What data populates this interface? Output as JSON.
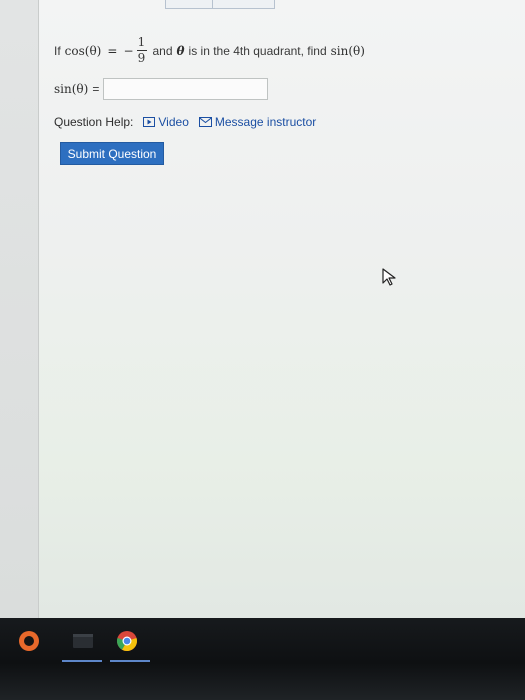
{
  "question": {
    "prefix": "If",
    "func1": "cos(θ)",
    "equals": "=",
    "minus": "−",
    "numerator": "1",
    "denominator": "9",
    "middle_text": "and",
    "theta": "θ",
    "suffix_text": "is in the 4th quadrant, find",
    "func2": "sin(θ)"
  },
  "answer": {
    "label": "sin(θ)",
    "equals": "=",
    "value": ""
  },
  "help": {
    "label": "Question Help:",
    "video_label": "Video",
    "message_label": "Message instructor"
  },
  "submit": {
    "label": "Submit Question"
  },
  "taskbar": {
    "apps": [
      "record-icon",
      "files-icon",
      "chrome-icon"
    ]
  },
  "colors": {
    "link": "#1b4fa3",
    "button": "#2d6fc0",
    "taskbar": "#121416"
  }
}
